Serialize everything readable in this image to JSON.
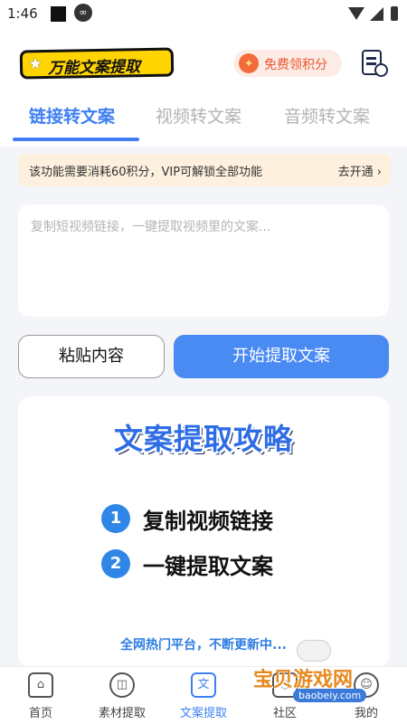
{
  "status_bar": {
    "time": "1:46"
  },
  "header": {
    "logo_text": "万能文案提取",
    "points_label": "免费领积分"
  },
  "tabs": [
    {
      "label": "链接转文案",
      "active": true
    },
    {
      "label": "视频转文案",
      "active": false
    },
    {
      "label": "音频转文案",
      "active": false
    }
  ],
  "notice": {
    "text": "该功能需要消耗60积分，VIP可解锁全部功能",
    "link": "去开通 ›"
  },
  "input": {
    "placeholder": "复制短视频链接，一键提取视频里的文案...",
    "value": ""
  },
  "actions": {
    "paste_label": "粘贴内容",
    "extract_label": "开始提取文案"
  },
  "guide": {
    "title": "文案提取攻略",
    "steps": [
      {
        "num": "1",
        "text": "复制视频链接"
      },
      {
        "num": "2",
        "text": "一键提取文案"
      }
    ],
    "footer": "全网热门平台，不断更新中..."
  },
  "bottom_nav": [
    {
      "label": "首页",
      "icon": "home-icon"
    },
    {
      "label": "素材提取",
      "icon": "material-icon"
    },
    {
      "label": "文案提取",
      "icon": "text-extract-icon",
      "glyph": "文",
      "active": true
    },
    {
      "label": "社区",
      "icon": "community-icon"
    },
    {
      "label": "我的",
      "icon": "mine-icon"
    }
  ],
  "watermark": {
    "text": "宝贝游戏网",
    "url": "baobeiy.com"
  },
  "colors": {
    "accent": "#3f7ff1",
    "notice_bg": "#fdf0de",
    "points_text": "#e9562f",
    "logo_bg": "#ffd400"
  }
}
